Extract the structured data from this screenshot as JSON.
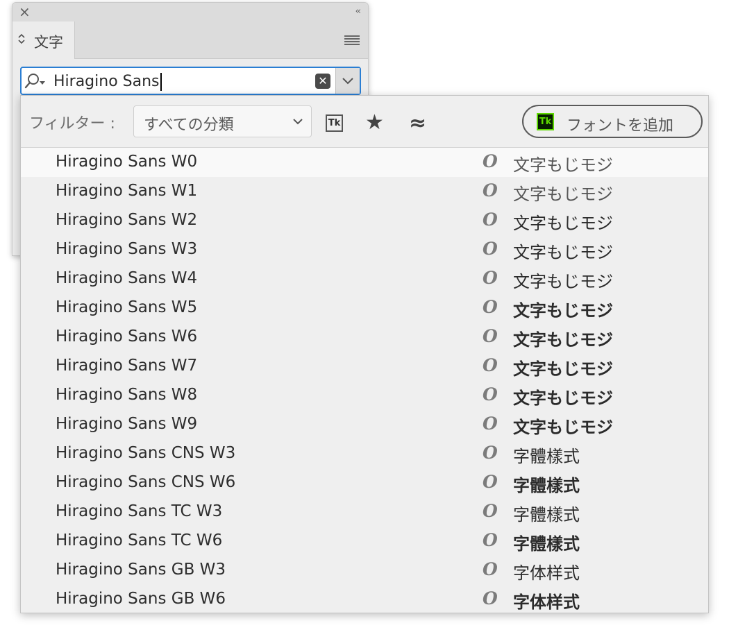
{
  "panel": {
    "close_icon": "×",
    "collapse_icon": "‹‹",
    "tab_label": "文字",
    "tab_arrows_icon": "⌃⌄"
  },
  "search": {
    "value": "Hiragino Sans",
    "clear_icon": "✕"
  },
  "filter": {
    "label": "フィルター :",
    "select_value": "すべての分類",
    "add_fonts_label": "フォントを追加",
    "tk_label": "Tk",
    "favorites_icon": "★",
    "similar_icon": "≈"
  },
  "fonts": [
    {
      "name": "Hiragino Sans W0",
      "sample": "文字もじモジ",
      "weight": 100
    },
    {
      "name": "Hiragino Sans W1",
      "sample": "文字もじモジ",
      "weight": 200
    },
    {
      "name": "Hiragino Sans W2",
      "sample": "文字もじモジ",
      "weight": 300
    },
    {
      "name": "Hiragino Sans W3",
      "sample": "文字もじモジ",
      "weight": 400
    },
    {
      "name": "Hiragino Sans W4",
      "sample": "文字もじモジ",
      "weight": 500
    },
    {
      "name": "Hiragino Sans W5",
      "sample": "文字もじモジ",
      "weight": 600
    },
    {
      "name": "Hiragino Sans W6",
      "sample": "文字もじモジ",
      "weight": 700
    },
    {
      "name": "Hiragino Sans W7",
      "sample": "文字もじモジ",
      "weight": 800
    },
    {
      "name": "Hiragino Sans W8",
      "sample": "文字もじモジ",
      "weight": 900
    },
    {
      "name": "Hiragino Sans W9",
      "sample": "文字もじモジ",
      "weight": 900
    },
    {
      "name": "Hiragino Sans CNS W3",
      "sample": "字體樣式",
      "weight": 400
    },
    {
      "name": "Hiragino Sans CNS W6",
      "sample": "字體樣式",
      "weight": 700
    },
    {
      "name": "Hiragino Sans TC W3",
      "sample": "字體樣式",
      "weight": 400
    },
    {
      "name": "Hiragino Sans TC W6",
      "sample": "字體樣式",
      "weight": 700
    },
    {
      "name": "Hiragino Sans GB W3",
      "sample": "字体样式",
      "weight": 400
    },
    {
      "name": "Hiragino Sans GB W6",
      "sample": "字体样式",
      "weight": 700
    }
  ],
  "otf_icon": "O"
}
